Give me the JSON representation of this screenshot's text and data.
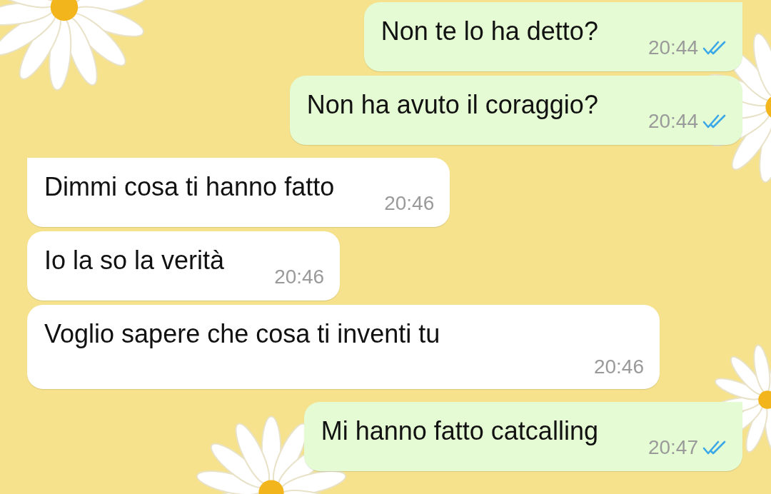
{
  "messages": [
    {
      "text": "Non te lo ha detto?",
      "time": "20:44",
      "outgoing": true,
      "tail": true,
      "read": true,
      "kind": "inline"
    },
    {
      "text": "Non ha avuto il coraggio?",
      "time": "20:44",
      "outgoing": true,
      "tail": false,
      "read": true,
      "kind": "inline"
    },
    {
      "text": "Dimmi cosa ti hanno fatto",
      "time": "20:46",
      "outgoing": false,
      "tail": true,
      "kind": "inline"
    },
    {
      "text": "Io la so la verità",
      "time": "20:46",
      "outgoing": false,
      "tail": false,
      "kind": "inline"
    },
    {
      "text": "Voglio sapere che cosa ti inventi tu",
      "time": "20:46",
      "outgoing": false,
      "tail": false,
      "kind": "stacked"
    },
    {
      "text": "Mi hanno fatto catcalling",
      "time": "20:47",
      "outgoing": true,
      "tail": true,
      "read": true,
      "kind": "inline"
    }
  ]
}
